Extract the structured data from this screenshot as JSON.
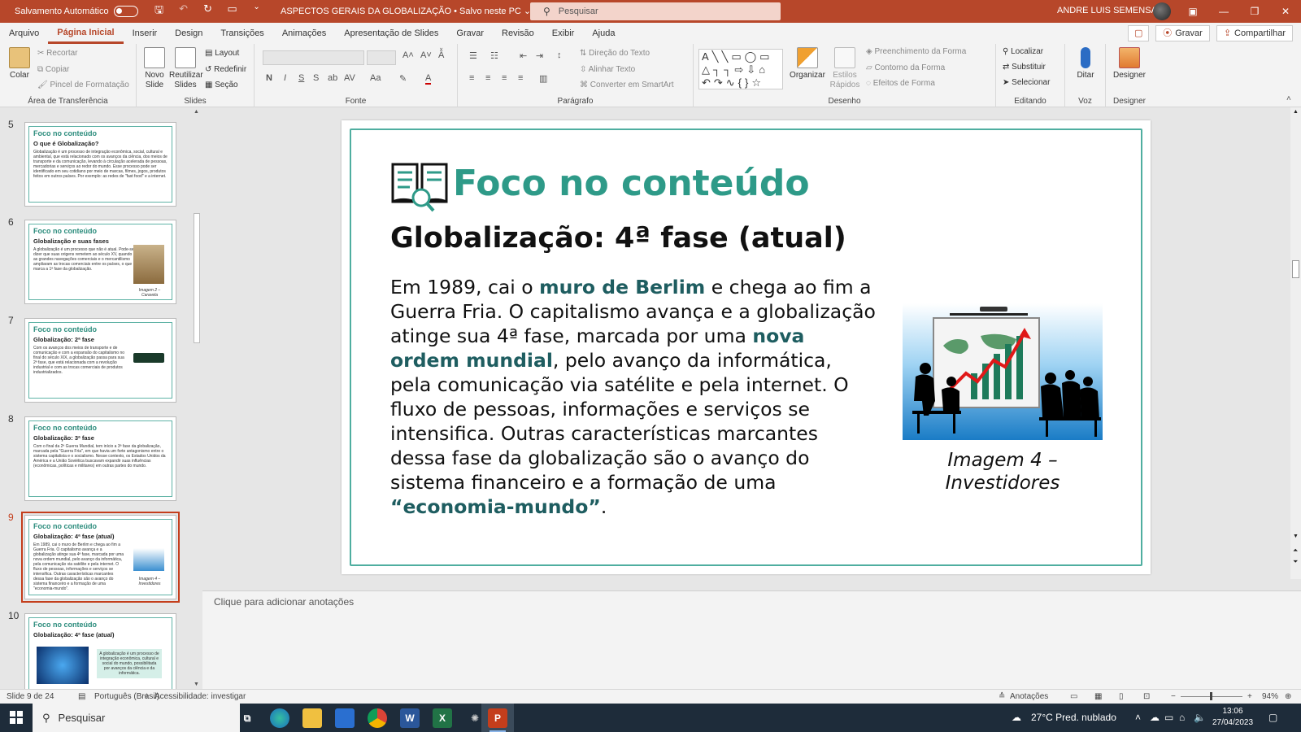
{
  "titlebar": {
    "autosave_label": "Salvamento Automático",
    "doc_title": "ASPECTOS GERAIS DA GLOBALIZAÇÃO • Salvo neste PC ⌄",
    "search_placeholder": "Pesquisar",
    "user_name": "ANDRE LUIS SEMENSATO"
  },
  "menu": {
    "tabs": [
      "Arquivo",
      "Página Inicial",
      "Inserir",
      "Design",
      "Transições",
      "Animações",
      "Apresentação de Slides",
      "Gravar",
      "Revisão",
      "Exibir",
      "Ajuda"
    ],
    "active": "Página Inicial",
    "record_label": "Gravar",
    "share_label": "Compartilhar"
  },
  "ribbon": {
    "clipboard": {
      "label": "Área de Transferência",
      "paste": "Colar",
      "cut": "Recortar",
      "copy": "Copiar",
      "format_painter": "Pincel de Formatação"
    },
    "slides": {
      "label": "Slides",
      "new_slide": "Novo Slide",
      "reuse": "Reutilizar Slides",
      "layout": "Layout",
      "reset": "Redefinir",
      "section": "Seção"
    },
    "font": {
      "label": "Fonte"
    },
    "paragraph": {
      "label": "Parágrafo",
      "text_direction": "Direção do Texto",
      "align_text": "Alinhar Texto",
      "smartart": "Converter em SmartArt"
    },
    "drawing": {
      "label": "Desenho",
      "arrange": "Organizar",
      "quick_styles": "Estilos Rápidos",
      "fill": "Preenchimento da Forma",
      "outline": "Contorno da Forma",
      "effects": "Efeitos de Forma"
    },
    "editing": {
      "label": "Editando",
      "find": "Localizar",
      "replace": "Substituir",
      "select": "Selecionar"
    },
    "voice": {
      "label": "Voz",
      "dictate": "Ditar"
    },
    "designer": {
      "label": "Designer",
      "designer": "Designer"
    }
  },
  "thumbnails": [
    {
      "num": "5",
      "header": "Foco no conteúdo",
      "subtitle": "O que é Globalização?",
      "body": "Globalização é um processo de integração econômica, social, cultural e ambiental, que está relacionado com os avanços da ciência, dos meios de transporte e da comunicação, levando à circulação acelerada de pessoas, mercadorias e serviços ao redor do mundo. Esse processo pode ser identificado em seu cotidiano por meio de marcas, filmes, jogos, produtos feitos em outros países. Por exemplo: as redes de \"fast food\" e a internet."
    },
    {
      "num": "6",
      "header": "Foco no conteúdo",
      "subtitle": "Globalização e suas fases",
      "body": "A globalização é um processo que não é atual. Pode-se dizer que suas origens remetem ao século XV, quando as grandes navegações comerciais e o mercantilismo ampliaram as trocas comerciais entre os países, o que marca a 1ª fase da globalização.",
      "caption": "Imagem 2 – Caravela"
    },
    {
      "num": "7",
      "header": "Foco no conteúdo",
      "subtitle": "Globalização: 2ª fase",
      "body": "Com os avanços dos meios de transporte e de comunicação e com a expansão do capitalismo no final do século XIX, a globalização passa para sua 2ª fase, que está relacionada com a revolução industrial e com as trocas comerciais de produtos industrializados."
    },
    {
      "num": "8",
      "header": "Foco no conteúdo",
      "subtitle": "Globalização: 3ª fase",
      "body": "Com o final da 2ª Guerra Mundial, tem início a 3ª fase da globalização, marcada pela \"Guerra Fria\", em que havia um forte antagonismo entre o sistema capitalista e o socialismo. Nesse contexto, os Estados Unidos da América e a União Soviética buscavam expandir suas influências (econômicas, políticas e militares) em outras partes do mundo."
    },
    {
      "num": "9",
      "header": "Foco no conteúdo",
      "subtitle": "Globalização: 4ª fase (atual)",
      "body": "Em 1989, cai o muro de Berlim e chega ao fim a Guerra Fria. O capitalismo avança e a globalização atinge sua 4ª fase, marcada por uma nova ordem mundial, pelo avanço da informática, pela comunicação via satélite e pela internet. O fluxo de pessoas, informações e serviços se intensifica. Outras características marcantes dessa fase da globalização são o avanço do sistema financeiro e a formação de uma \"economia-mundo\".",
      "caption": "Imagem 4 – Investidores"
    },
    {
      "num": "10",
      "header": "Foco no conteúdo",
      "subtitle": "Globalização: 4ª fase (atual)",
      "body": "A globalização é um processo de integração econômica, cultural e social do mundo, possibilitada por avanços da ciência e da informática."
    }
  ],
  "slide": {
    "title": "Foco no conteúdo",
    "subtitle": "Globalização: 4ª fase (atual)",
    "body": [
      {
        "t": "Em 1989, cai o ",
        "b": false
      },
      {
        "t": "muro de Berlim",
        "b": true
      },
      {
        "t": " e chega ao fim a Guerra Fria. O capitalismo avança e a globalização atinge sua 4ª fase, marcada por uma ",
        "b": false
      },
      {
        "t": "nova ordem mundial",
        "b": true
      },
      {
        "t": ", pelo avanço da informática, pela comunicação via satélite e pela internet. O fluxo de pessoas, informações e serviços se intensifica. Outras características marcantes dessa fase da globalização são o avanço do sistema financeiro e a formação de uma ",
        "b": false
      },
      {
        "t": "“economia-mundo”",
        "b": true
      },
      {
        "t": ".",
        "b": false
      }
    ],
    "caption_line1": "Imagem 4 –",
    "caption_line2": "Investidores",
    "accent_color": "#2e9a88",
    "highlight_color": "#1e5d60"
  },
  "notes": {
    "placeholder": "Clique para adicionar anotações"
  },
  "status": {
    "slide_count": "Slide 9 de 24",
    "language": "Português (Brasil)",
    "accessibility": "Acessibilidade: investigar",
    "notes": "Anotações",
    "zoom": "94%"
  },
  "taskbar": {
    "search": "Pesquisar",
    "weather": "27°C  Pred. nublado",
    "time": "13:06",
    "date": "27/04/2023"
  }
}
